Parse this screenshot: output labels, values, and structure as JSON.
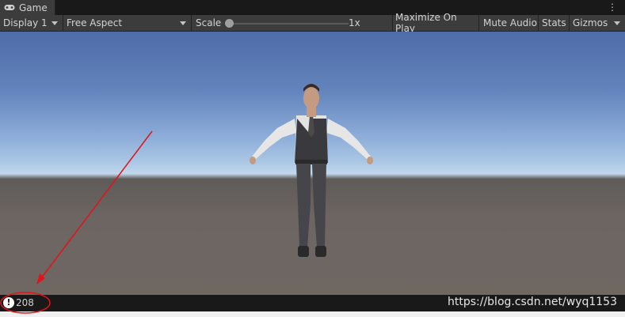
{
  "window": {
    "tab_title": "Game",
    "tab_icon": "gamepad-icon",
    "menu_icon": "kebab-menu-icon"
  },
  "toolbar": {
    "display": "Display 1",
    "aspect": "Free Aspect",
    "scale_label": "Scale",
    "scale_value": "1x",
    "scale_level": 0.02,
    "maximize_on_play": "Maximize On Play",
    "mute_audio": "Mute Audio",
    "stats": "Stats",
    "gizmos": "Gizmos"
  },
  "viewport": {
    "scene": "3D character in T-pose",
    "sky_color": "#6283bb",
    "ground_color": "#6c6562"
  },
  "status": {
    "icon": "warning-icon",
    "count": "208"
  },
  "watermark": "https://blog.csdn.net/wyq1153",
  "annotation": {
    "color": "#e0141b"
  }
}
